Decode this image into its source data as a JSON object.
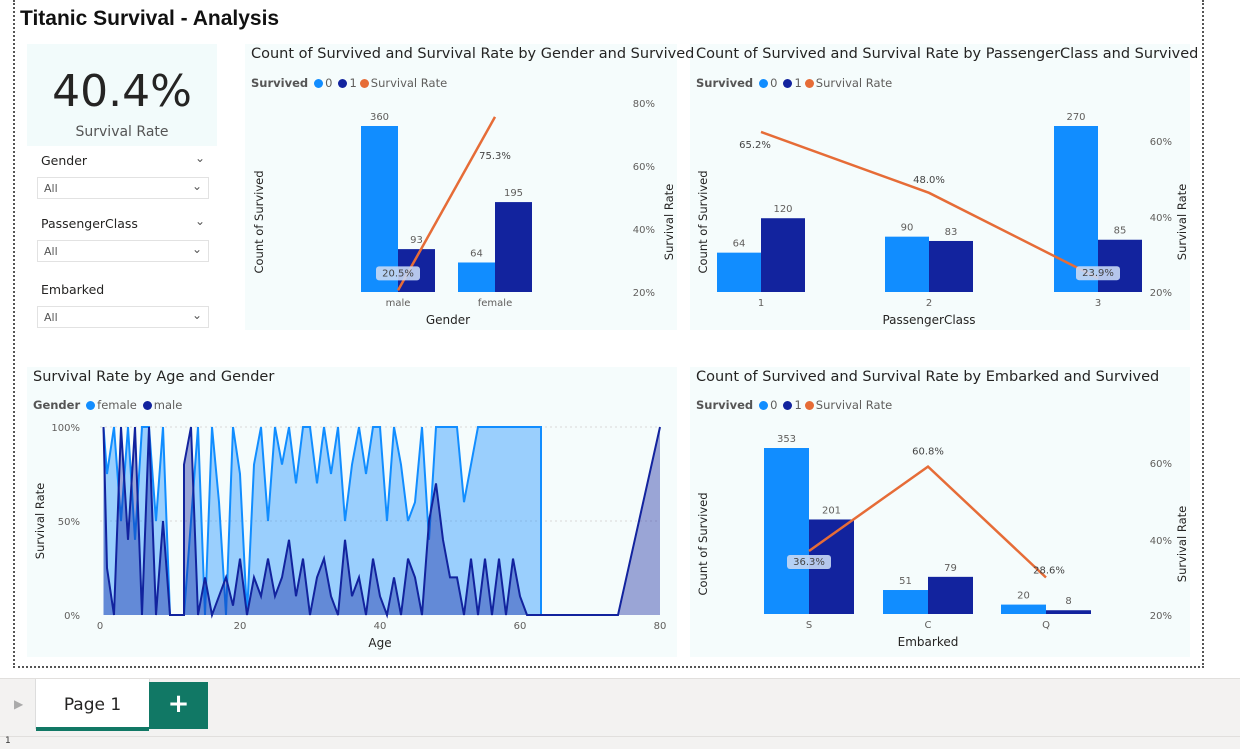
{
  "report_title": "Titanic Survival - Analysis",
  "kpi": {
    "value": "40.4%",
    "label": "Survival Rate"
  },
  "slicers": [
    {
      "label": "Gender",
      "value": "All"
    },
    {
      "label": "PassengerClass",
      "value": "All"
    },
    {
      "label": "Embarked",
      "value": "All"
    }
  ],
  "chart_data": [
    {
      "type": "bar+line",
      "title": "Count of Survived and Survival Rate by Gender and Survived",
      "legend_title": "Survived",
      "series": [
        {
          "name": "0",
          "color": "#118dff",
          "values": [
            360,
            64
          ]
        },
        {
          "name": "1",
          "color": "#12239e",
          "values": [
            93,
            195
          ]
        }
      ],
      "line": {
        "name": "Survival Rate",
        "color": "#e66c37",
        "values": [
          20.5,
          75.3
        ],
        "labels": [
          "20.5%",
          "75.3%"
        ]
      },
      "categories": [
        "male",
        "female"
      ],
      "xlabel": "Gender",
      "ylabel": "Count of Survived",
      "y2label": "Survival Rate",
      "y2ticks": [
        "80%",
        "60%",
        "40%",
        "20%"
      ]
    },
    {
      "type": "bar+line",
      "title": "Count of Survived and Survival Rate by PassengerClass and Survived",
      "legend_title": "Survived",
      "series": [
        {
          "name": "0",
          "color": "#118dff",
          "values": [
            64,
            90,
            270
          ]
        },
        {
          "name": "1",
          "color": "#12239e",
          "values": [
            120,
            83,
            85
          ]
        }
      ],
      "line": {
        "name": "Survival Rate",
        "color": "#e66c37",
        "values": [
          65.2,
          48.0,
          23.9
        ],
        "labels": [
          "65.2%",
          "48.0%",
          "23.9%"
        ]
      },
      "categories": [
        "1",
        "2",
        "3"
      ],
      "xlabel": "PassengerClass",
      "ylabel": "Count of Survived",
      "y2label": "Survival Rate",
      "y2ticks": [
        "60%",
        "40%",
        "20%"
      ]
    },
    {
      "type": "area",
      "title": "Survival Rate by Age and Gender",
      "legend_title": "Gender",
      "series": [
        {
          "name": "female",
          "color": "#118dff"
        },
        {
          "name": "male",
          "color": "#12239e"
        }
      ],
      "xlabel": "Age",
      "ylabel": "Survival Rate",
      "xticks": [
        "0",
        "20",
        "40",
        "60",
        "80"
      ],
      "yticks": [
        "100%",
        "50%",
        "0%"
      ],
      "xlim": [
        0,
        80
      ],
      "ylim": [
        0,
        100
      ]
    },
    {
      "type": "bar+line",
      "title": "Count of Survived and Survival Rate by Embarked and Survived",
      "legend_title": "Survived",
      "series": [
        {
          "name": "0",
          "color": "#118dff",
          "values": [
            353,
            51,
            20
          ]
        },
        {
          "name": "1",
          "color": "#12239e",
          "values": [
            201,
            79,
            8
          ]
        }
      ],
      "line": {
        "name": "Survival Rate",
        "color": "#e66c37",
        "values": [
          36.3,
          60.8,
          28.6
        ],
        "labels": [
          "36.3%",
          "60.8%",
          "28.6%"
        ]
      },
      "categories": [
        "S",
        "C",
        "Q"
      ],
      "xlabel": "Embarked",
      "ylabel": "Count of Survived",
      "y2label": "Survival Rate",
      "y2ticks": [
        "60%",
        "40%",
        "20%"
      ]
    }
  ],
  "tabs": {
    "page1": "Page 1",
    "add": "+"
  },
  "status": {
    "page_num": "1"
  }
}
